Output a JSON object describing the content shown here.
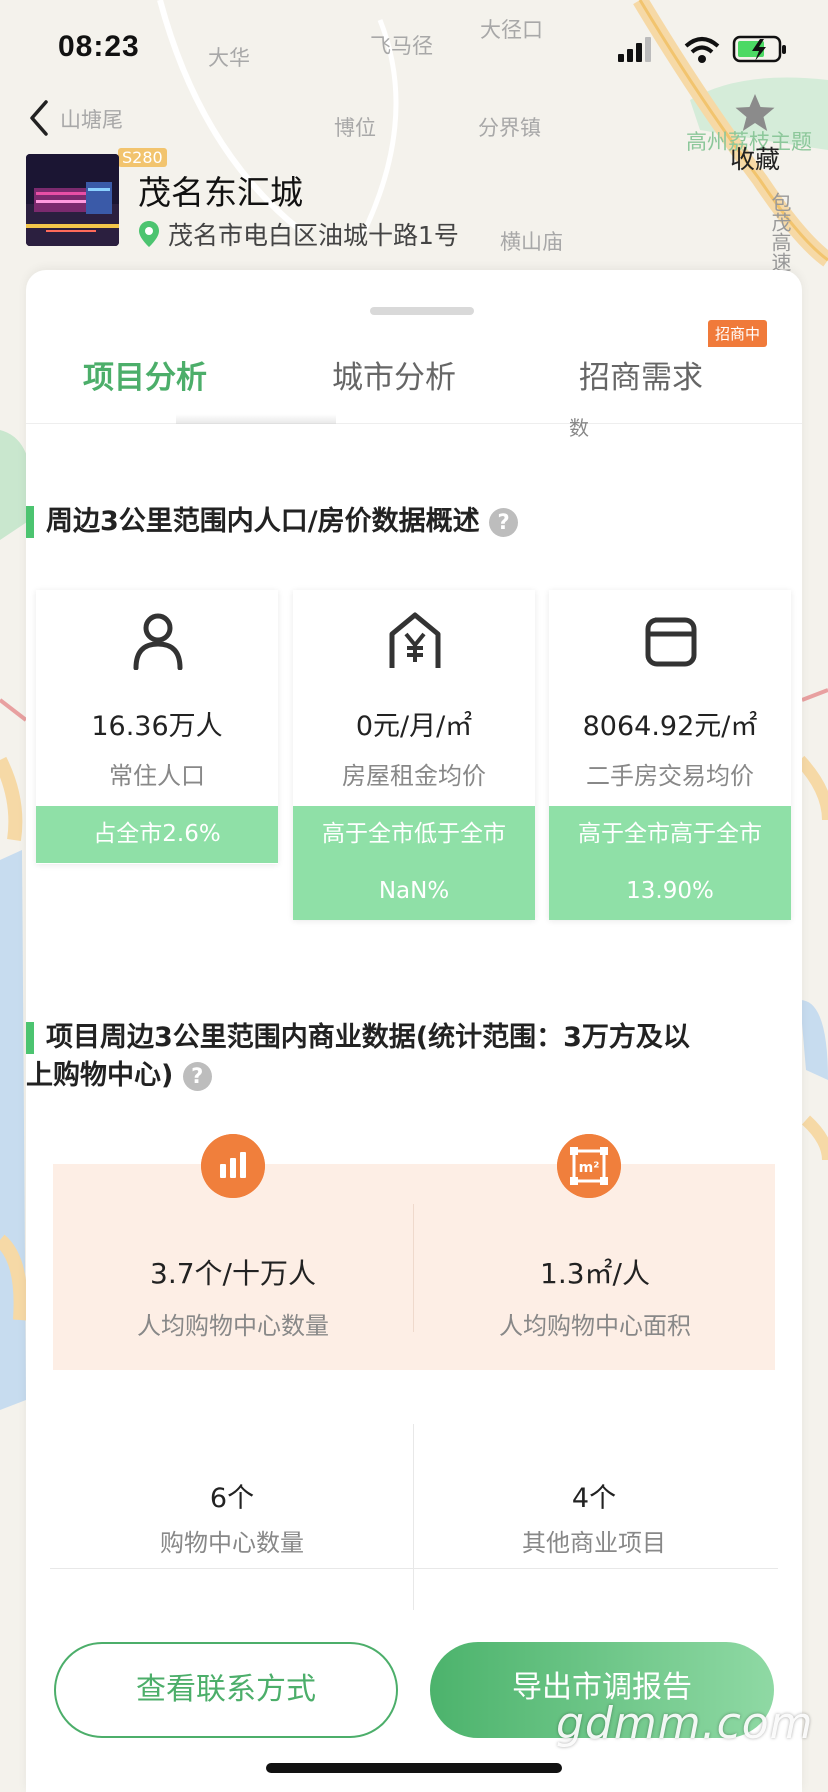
{
  "status_bar": {
    "time": "08:23"
  },
  "map_labels": [
    {
      "name": "map-label-dajingkou",
      "text": "大径口"
    },
    {
      "name": "map-label-dahua",
      "text": "大华"
    },
    {
      "name": "map-label-feimajing",
      "text": "飞马径"
    },
    {
      "name": "map-label-shantangwei",
      "text": "山塘尾"
    },
    {
      "name": "map-label-bowei",
      "text": "博位"
    },
    {
      "name": "map-label-fenjiezhen",
      "text": "分界镇"
    },
    {
      "name": "map-label-gaozhou",
      "text": "高州荔枝主题"
    },
    {
      "name": "map-label-hengshanmiao",
      "text": "横山庙"
    },
    {
      "name": "map-label-s280",
      "text": "S280"
    },
    {
      "name": "map-label-bao",
      "text": "包茂高速"
    }
  ],
  "header": {
    "back_icon": "chevron-left-icon",
    "favorite_icon": "star-icon",
    "favorite_label": "收藏",
    "venue_name": "茂名东汇城",
    "venue_address": "茂名市电白区油城十路1号",
    "location_icon": "location-pin-icon"
  },
  "tabs": [
    {
      "label": "项目分析",
      "active": true
    },
    {
      "label": "城市分析",
      "active": false
    },
    {
      "label": "招商需求",
      "active": false,
      "badge": "招商中"
    }
  ],
  "cut_off_text": {
    "right": "数"
  },
  "population_section": {
    "title": "周边3公里范围内人口/房价数据概述",
    "help_icon": "question-circle-icon",
    "cards": [
      {
        "icon": "person-icon",
        "value": "16.36万人",
        "label": "常住人口",
        "footer_line1": "占全市2.6%",
        "footer_line2": ""
      },
      {
        "icon": "house-yuan-icon",
        "value": "0元/月/㎡",
        "label": "房屋租金均价",
        "footer_line1": "高于全市低于全市",
        "footer_line2": "NaN%"
      },
      {
        "icon": "wallet-icon",
        "value": "8064.92元/㎡",
        "label": "二手房交易均价",
        "footer_line1": "高于全市高于全市",
        "footer_line2": "13.90%"
      }
    ]
  },
  "commercial_section": {
    "title_line1": "项目周边3公里范围内商业数据(统计范围：3万方及以",
    "title_line2": "上购物中心)",
    "help_icon": "question-circle-icon",
    "highlights": [
      {
        "icon": "bar-chart-icon",
        "value": "3.7个/十万人",
        "label": "人均购物中心数量"
      },
      {
        "icon": "area-m2-icon",
        "value": "1.3㎡/人",
        "label": "人均购物中心面积"
      }
    ],
    "grid": [
      {
        "value": "6个",
        "label": "购物中心数量"
      },
      {
        "value": "4个",
        "label": "其他商业项目"
      }
    ]
  },
  "actions": {
    "contact_label": "查看联系方式",
    "export_label": "导出市调报告"
  },
  "watermark": "gdmm.com",
  "colors": {
    "accent_green": "#4cae6a",
    "card_footer_green": "#8fe0a7",
    "orange": "#f07f3c",
    "peach_panel": "#fdeee5"
  }
}
